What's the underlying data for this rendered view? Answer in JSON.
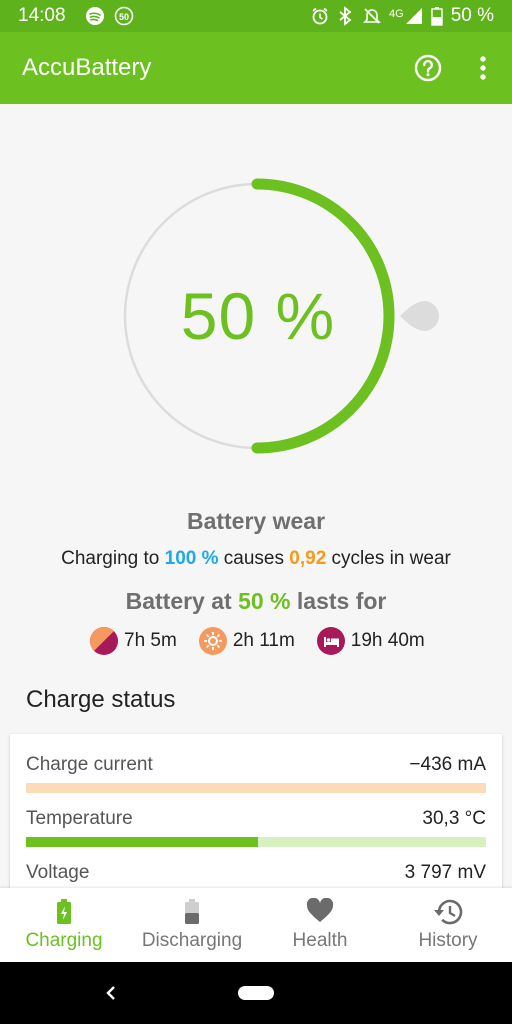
{
  "status_bar": {
    "time": "14:08",
    "spotify_icon": "spotify-icon",
    "badge_icon_label": "50",
    "network": "4G",
    "battery_text": "50 %"
  },
  "app_bar": {
    "title": "AccuBattery",
    "help_icon": "help-circle-icon",
    "more_icon": "more-vert-icon"
  },
  "gauge": {
    "percent_text": "50 %",
    "charge_fraction": 0.5,
    "accent": "#6cc01f",
    "track": "#dcdcdc"
  },
  "battery_wear": {
    "title": "Battery wear",
    "prefix": "Charging to ",
    "target": "100 %",
    "middle": " causes ",
    "cycles": "0,92",
    "suffix": " cycles in wear"
  },
  "lasts": {
    "prefix": "Battery at ",
    "percent": "50 %",
    "suffix": " lasts for",
    "items": [
      {
        "icon": "screen-mixed-icon",
        "value": "7h 5m",
        "color": "#a8195a"
      },
      {
        "icon": "screen-on-icon",
        "value": "2h 11m",
        "color": "#f59a5f"
      },
      {
        "icon": "sleep-bed-icon",
        "value": "19h 40m",
        "color": "#a8195a"
      }
    ]
  },
  "charge_status": {
    "title": "Charge status",
    "rows": [
      {
        "label": "Charge current",
        "value": "−436 mA",
        "fill_fraction": 0,
        "bar_color": "#fcdcb6",
        "track_color": "#fcdcb6"
      },
      {
        "label": "Temperature",
        "value": "30,3 °C",
        "fill_fraction": 0.505,
        "bar_color": "#6cc01f",
        "track_color": "#d6f0c0"
      },
      {
        "label": "Voltage",
        "value": "3 797 mV"
      }
    ]
  },
  "bottom_nav": {
    "items": [
      {
        "label": "Charging",
        "icon": "battery-charging-icon",
        "active": true
      },
      {
        "label": "Discharging",
        "icon": "battery-half-icon",
        "active": false
      },
      {
        "label": "Health",
        "icon": "heart-icon",
        "active": false
      },
      {
        "label": "History",
        "icon": "history-icon",
        "active": false
      }
    ]
  },
  "colors": {
    "primary": "#6cc01f",
    "primary_dark": "#5eb31c",
    "blue": "#1fa9e8",
    "orange": "#f59a1b"
  }
}
